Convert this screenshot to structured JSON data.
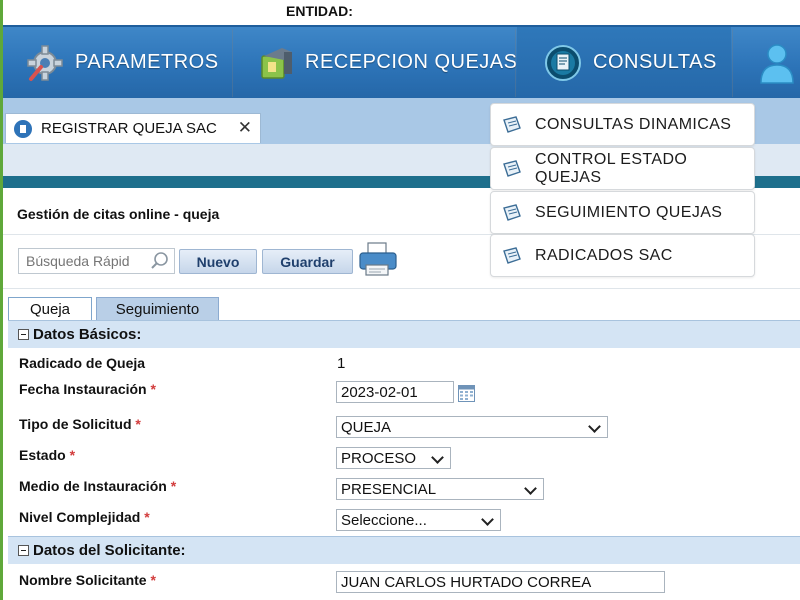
{
  "entity": {
    "label": "ENTIDAD:"
  },
  "nav": {
    "items": [
      {
        "label": "PARAMETROS",
        "icon": "gear-icon"
      },
      {
        "label": "RECEPCION QUEJAS",
        "icon": "mailbox-icon"
      },
      {
        "label": "CONSULTAS",
        "icon": "document-icon"
      },
      {
        "label": "",
        "icon": "user-icon"
      }
    ],
    "active": "CONSULTAS"
  },
  "tab": {
    "label": "REGISTRAR QUEJA SAC",
    "close": "✕"
  },
  "dropdown": {
    "items": [
      "CONSULTAS DINAMICAS",
      "CONTROL ESTADO QUEJAS",
      "SEGUIMIENTO QUEJAS",
      "RADICADOS SAC"
    ]
  },
  "page": {
    "title": "Gestión de citas online - queja"
  },
  "toolbar": {
    "search_placeholder": "Búsqueda Rápid",
    "new_label": "Nuevo",
    "save_label": "Guardar"
  },
  "subtabs": [
    "Queja",
    "Seguimiento"
  ],
  "groups": {
    "basic": "Datos Básicos:",
    "requester": "Datos del Solicitante:"
  },
  "fields": {
    "radicado": {
      "label": "Radicado de Queja",
      "value": "1"
    },
    "fecha": {
      "label": "Fecha Instauración",
      "value": "2023-02-01"
    },
    "tipo": {
      "label": "Tipo de Solicitud",
      "value": "QUEJA"
    },
    "estado": {
      "label": "Estado",
      "value": "PROCESO"
    },
    "medio": {
      "label": "Medio de Instauración",
      "value": "PRESENCIAL"
    },
    "nivel": {
      "label": "Nivel Complejidad",
      "value": "Seleccione..."
    },
    "nombre": {
      "label": "Nombre Solicitante",
      "value": "JUAN CARLOS HURTADO CORREA"
    }
  },
  "required_mark": "*",
  "colors": {
    "nav_blue": "#2d74b8",
    "band_dark": "#1e6f8c",
    "required": "#d23c3c",
    "group_header": "#d4e4f4"
  }
}
